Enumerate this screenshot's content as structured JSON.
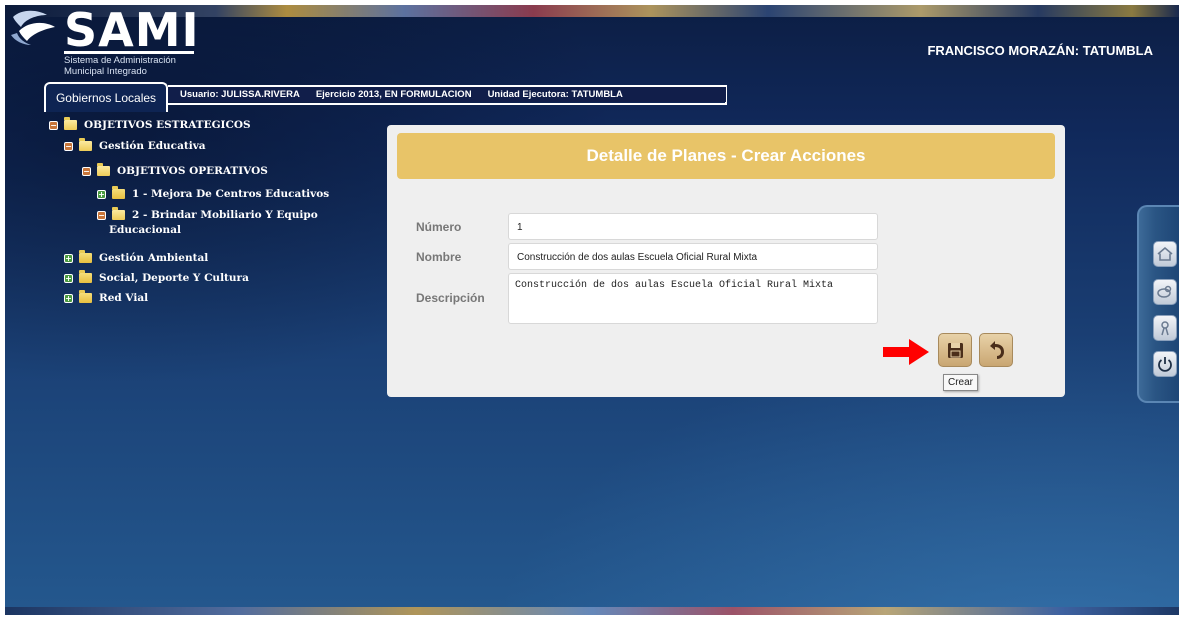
{
  "header": {
    "logo_title": "SAMI",
    "logo_subtitle_1": "Sistema de Administración",
    "logo_subtitle_2": "Municipal Integrado",
    "region": "FRANCISCO MORAZÁN: TATUMBLA"
  },
  "tabs": {
    "active_tab": "Gobiernos Locales"
  },
  "infobar": {
    "usuario": "Usuario: JULISSA.RIVERA",
    "ejercicio": "Ejercicio 2013, EN FORMULACION",
    "unidad": "Unidad Ejecutora: TATUMBLA"
  },
  "tree": {
    "root": "OBJETIVOS ESTRATEGICOS",
    "item_1": "Gestión Educativa",
    "item_1_1": "OBJETIVOS OPERATIVOS",
    "item_1_1_1": "1 - Mejora De Centros Educativos",
    "item_1_1_2_line1": "2 - Brindar Mobiliario Y Equipo",
    "item_1_1_2_line2": "Educacional",
    "item_2": "Gestión Ambiental",
    "item_3": "Social, Deporte Y Cultura",
    "item_4": "Red Vial"
  },
  "form": {
    "title": "Detalle de Planes - Crear Acciones",
    "numero_label": "Número",
    "numero_value": "1",
    "nombre_label": "Nombre",
    "nombre_value": "Construcción de dos aulas Escuela Oficial Rural Mixta",
    "descripcion_label": "Descripción",
    "descripcion_value": "Construcción de dos aulas Escuela Oficial Rural Mixta",
    "save_tooltip": "Crear"
  },
  "sidebar": {
    "icons": [
      "home-icon",
      "key-icon",
      "user-icon",
      "power-icon"
    ]
  },
  "colors": {
    "header_accent": "#e8c468",
    "panel_bg": "#efefef",
    "arrow": "#ff0000"
  }
}
